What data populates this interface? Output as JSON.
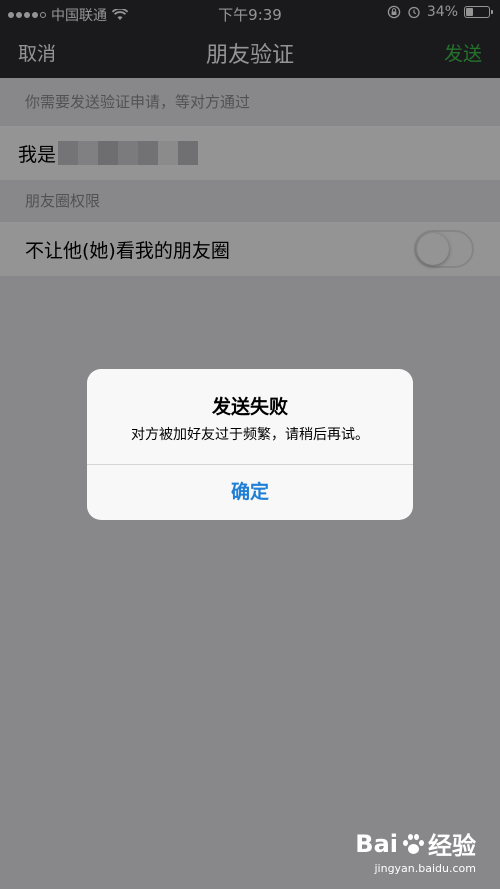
{
  "status_bar": {
    "carrier": "中国联通",
    "time": "下午9:39",
    "battery_percent": "34%",
    "battery_level": 0.34
  },
  "nav": {
    "cancel_label": "取消",
    "title": "朋友验证",
    "send_label": "发送",
    "send_color": "#3ec34a"
  },
  "request": {
    "section_header": "你需要发送验证申请，等对方通过",
    "prefix": "我是"
  },
  "moments": {
    "section_header": "朋友圈权限",
    "toggle_label": "不让他(她)看我的朋友圈",
    "toggle_on": false
  },
  "alert": {
    "title": "发送失败",
    "message": "对方被加好友过于频繁，请稍后再试。",
    "ok_label": "确定",
    "ok_color": "#1f7fd6"
  },
  "watermark": {
    "brand": "Bai",
    "brand_suffix": "经验",
    "url": "jingyan.baidu.com"
  }
}
